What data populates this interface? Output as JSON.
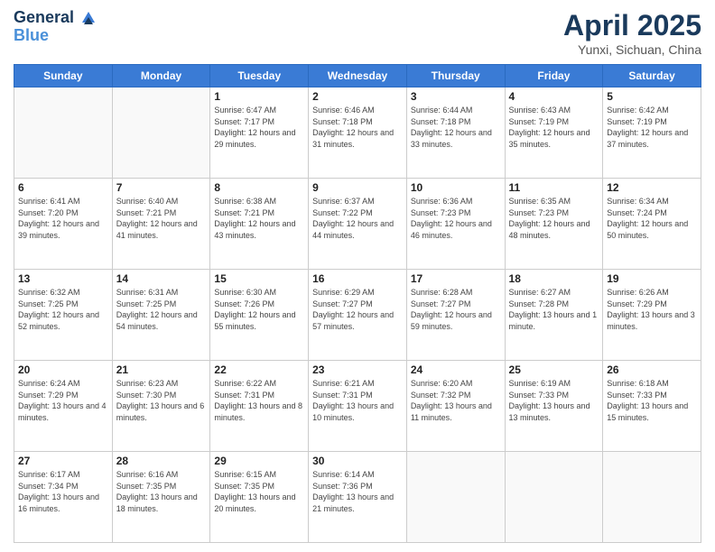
{
  "logo": {
    "line1": "General",
    "line2": "Blue"
  },
  "title": "April 2025",
  "subtitle": "Yunxi, Sichuan, China",
  "weekdays": [
    "Sunday",
    "Monday",
    "Tuesday",
    "Wednesday",
    "Thursday",
    "Friday",
    "Saturday"
  ],
  "weeks": [
    [
      {
        "day": "",
        "info": ""
      },
      {
        "day": "",
        "info": ""
      },
      {
        "day": "1",
        "info": "Sunrise: 6:47 AM\nSunset: 7:17 PM\nDaylight: 12 hours\nand 29 minutes."
      },
      {
        "day": "2",
        "info": "Sunrise: 6:46 AM\nSunset: 7:18 PM\nDaylight: 12 hours\nand 31 minutes."
      },
      {
        "day": "3",
        "info": "Sunrise: 6:44 AM\nSunset: 7:18 PM\nDaylight: 12 hours\nand 33 minutes."
      },
      {
        "day": "4",
        "info": "Sunrise: 6:43 AM\nSunset: 7:19 PM\nDaylight: 12 hours\nand 35 minutes."
      },
      {
        "day": "5",
        "info": "Sunrise: 6:42 AM\nSunset: 7:19 PM\nDaylight: 12 hours\nand 37 minutes."
      }
    ],
    [
      {
        "day": "6",
        "info": "Sunrise: 6:41 AM\nSunset: 7:20 PM\nDaylight: 12 hours\nand 39 minutes."
      },
      {
        "day": "7",
        "info": "Sunrise: 6:40 AM\nSunset: 7:21 PM\nDaylight: 12 hours\nand 41 minutes."
      },
      {
        "day": "8",
        "info": "Sunrise: 6:38 AM\nSunset: 7:21 PM\nDaylight: 12 hours\nand 43 minutes."
      },
      {
        "day": "9",
        "info": "Sunrise: 6:37 AM\nSunset: 7:22 PM\nDaylight: 12 hours\nand 44 minutes."
      },
      {
        "day": "10",
        "info": "Sunrise: 6:36 AM\nSunset: 7:23 PM\nDaylight: 12 hours\nand 46 minutes."
      },
      {
        "day": "11",
        "info": "Sunrise: 6:35 AM\nSunset: 7:23 PM\nDaylight: 12 hours\nand 48 minutes."
      },
      {
        "day": "12",
        "info": "Sunrise: 6:34 AM\nSunset: 7:24 PM\nDaylight: 12 hours\nand 50 minutes."
      }
    ],
    [
      {
        "day": "13",
        "info": "Sunrise: 6:32 AM\nSunset: 7:25 PM\nDaylight: 12 hours\nand 52 minutes."
      },
      {
        "day": "14",
        "info": "Sunrise: 6:31 AM\nSunset: 7:25 PM\nDaylight: 12 hours\nand 54 minutes."
      },
      {
        "day": "15",
        "info": "Sunrise: 6:30 AM\nSunset: 7:26 PM\nDaylight: 12 hours\nand 55 minutes."
      },
      {
        "day": "16",
        "info": "Sunrise: 6:29 AM\nSunset: 7:27 PM\nDaylight: 12 hours\nand 57 minutes."
      },
      {
        "day": "17",
        "info": "Sunrise: 6:28 AM\nSunset: 7:27 PM\nDaylight: 12 hours\nand 59 minutes."
      },
      {
        "day": "18",
        "info": "Sunrise: 6:27 AM\nSunset: 7:28 PM\nDaylight: 13 hours\nand 1 minute."
      },
      {
        "day": "19",
        "info": "Sunrise: 6:26 AM\nSunset: 7:29 PM\nDaylight: 13 hours\nand 3 minutes."
      }
    ],
    [
      {
        "day": "20",
        "info": "Sunrise: 6:24 AM\nSunset: 7:29 PM\nDaylight: 13 hours\nand 4 minutes."
      },
      {
        "day": "21",
        "info": "Sunrise: 6:23 AM\nSunset: 7:30 PM\nDaylight: 13 hours\nand 6 minutes."
      },
      {
        "day": "22",
        "info": "Sunrise: 6:22 AM\nSunset: 7:31 PM\nDaylight: 13 hours\nand 8 minutes."
      },
      {
        "day": "23",
        "info": "Sunrise: 6:21 AM\nSunset: 7:31 PM\nDaylight: 13 hours\nand 10 minutes."
      },
      {
        "day": "24",
        "info": "Sunrise: 6:20 AM\nSunset: 7:32 PM\nDaylight: 13 hours\nand 11 minutes."
      },
      {
        "day": "25",
        "info": "Sunrise: 6:19 AM\nSunset: 7:33 PM\nDaylight: 13 hours\nand 13 minutes."
      },
      {
        "day": "26",
        "info": "Sunrise: 6:18 AM\nSunset: 7:33 PM\nDaylight: 13 hours\nand 15 minutes."
      }
    ],
    [
      {
        "day": "27",
        "info": "Sunrise: 6:17 AM\nSunset: 7:34 PM\nDaylight: 13 hours\nand 16 minutes."
      },
      {
        "day": "28",
        "info": "Sunrise: 6:16 AM\nSunset: 7:35 PM\nDaylight: 13 hours\nand 18 minutes."
      },
      {
        "day": "29",
        "info": "Sunrise: 6:15 AM\nSunset: 7:35 PM\nDaylight: 13 hours\nand 20 minutes."
      },
      {
        "day": "30",
        "info": "Sunrise: 6:14 AM\nSunset: 7:36 PM\nDaylight: 13 hours\nand 21 minutes."
      },
      {
        "day": "",
        "info": ""
      },
      {
        "day": "",
        "info": ""
      },
      {
        "day": "",
        "info": ""
      }
    ]
  ]
}
